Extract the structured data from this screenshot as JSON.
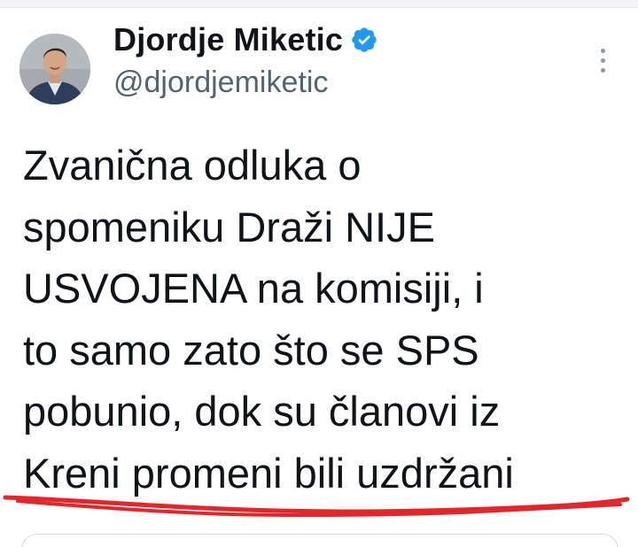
{
  "tweet": {
    "author": {
      "display_name": "Djordje Miketic",
      "handle": "@djordjemiketic",
      "verified": true,
      "verified_icon": "verified-badge-icon",
      "verified_color": "#1d9bf0",
      "avatar_icon": "profile-photo"
    },
    "menu_icon": "more-options-icon",
    "text_lines": [
      "Zvanična odluka o",
      "spomeniku Draži NIJE",
      "USVOJENA na komisiji, i",
      "to samo zato što se SPS",
      "pobunio, dok su članovi iz",
      "Kreni promeni bili uzdržani"
    ],
    "annotation": {
      "type": "red-underline",
      "color": "#e4262b"
    }
  }
}
